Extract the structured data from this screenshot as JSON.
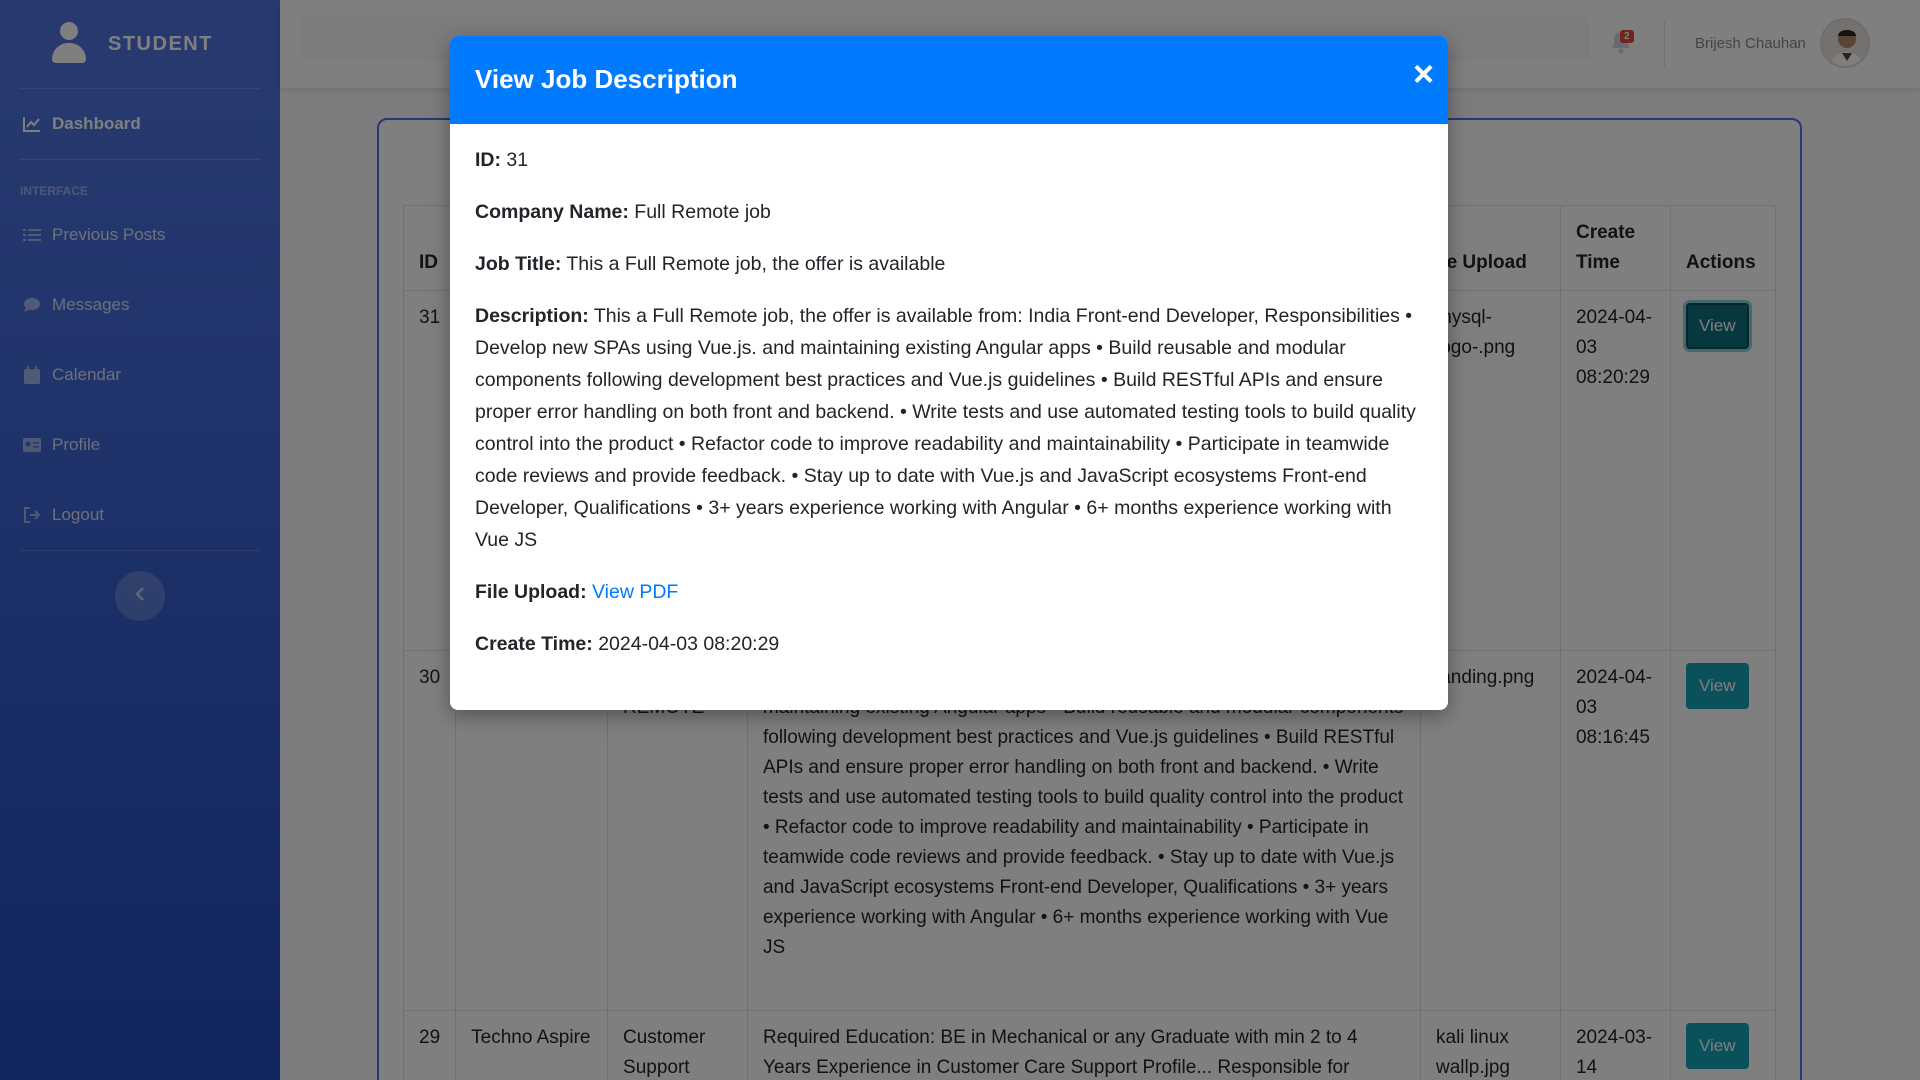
{
  "sidebar": {
    "brand": "STUDENT",
    "dashboard": "Dashboard",
    "heading": "INTERFACE",
    "items": [
      {
        "label": "Previous Posts",
        "icon": "list-icon"
      },
      {
        "label": "Messages",
        "icon": "chat-icon"
      },
      {
        "label": "Calendar",
        "icon": "calendar-icon"
      },
      {
        "label": "Profile",
        "icon": "id-card-icon"
      },
      {
        "label": "Logout",
        "icon": "logout-icon"
      }
    ]
  },
  "topbar": {
    "notification_count": "2",
    "user_name": "Brijesh Chauhan"
  },
  "table": {
    "headers": [
      "ID",
      "",
      "",
      "",
      "File Upload",
      "Create Time",
      "Actions"
    ],
    "header_id": "ID",
    "header_file": "ile Upload",
    "header_create": "Create Time",
    "header_actions": "Actions",
    "rows": [
      {
        "id": "31",
        "company": "",
        "title": "",
        "description": "",
        "file": "mysql-logo-.png",
        "time": "2024-04-03 08:20:29",
        "action": "View"
      },
      {
        "id": "30",
        "company": "",
        "title": "Developer - REMOTE",
        "description": "Developer, Responsibilities • Develop new SPAs using Vue.js. and maintaining existing Angular apps • Build reusable and modular components following development best practices and Vue.js guidelines • Build RESTful APIs and ensure proper error handling on both front and backend. • Write tests and use automated testing tools to build quality control into the product • Refactor code to improve readability and maintainability • Participate in teamwide code reviews and provide feedback. • Stay up to date with Vue.js and JavaScript ecosystems Front-end Developer, Qualifications • 3+ years experience working with Angular • 6+ months experience working with Vue JS",
        "file": "landing.png",
        "time": "2024-04-03 08:16:45",
        "action": "View"
      },
      {
        "id": "29",
        "company": "Techno Aspire",
        "title": "Customer Support",
        "description": "Required Education: BE in Mechanical or any Graduate with min 2 to 4 Years Experience in Customer Care Support Profile... Responsible for",
        "file": "kali linux wallp.jpg",
        "time": "2024-03-14",
        "action": "View"
      }
    ]
  },
  "modal": {
    "title": "View Job Description",
    "close": "×",
    "id_label": "ID:",
    "id_value": "31",
    "company_label": "Company Name:",
    "company_value": "Full Remote job",
    "title_label": "Job Title:",
    "title_value": "This a Full Remote job, the offer is available",
    "desc_label": "Description:",
    "desc_value": "This a Full Remote job, the offer is available from: India Front-end Developer, Responsibilities • Develop new SPAs using Vue.js. and maintaining existing Angular apps • Build reusable and modular components following development best practices and Vue.js guidelines • Build RESTful APIs and ensure proper error handling on both front and backend. • Write tests and use automated testing tools to build quality control into the product • Refactor code to improve readability and maintainability • Participate in teamwide code reviews and provide feedback. • Stay up to date with Vue.js and JavaScript ecosystems Front-end Developer, Qualifications • 3+ years experience working with Angular • 6+ months experience working with Vue JS",
    "file_label": "File Upload:",
    "file_link": "View PDF",
    "time_label": "Create Time:",
    "time_value": "2024-04-03 08:20:29"
  },
  "colors": {
    "sidebar_start": "#4e73df",
    "sidebar_end": "#224abe",
    "modal_header": "#007bff",
    "view_button": "#17a2b8",
    "badge": "#e74a3b"
  }
}
